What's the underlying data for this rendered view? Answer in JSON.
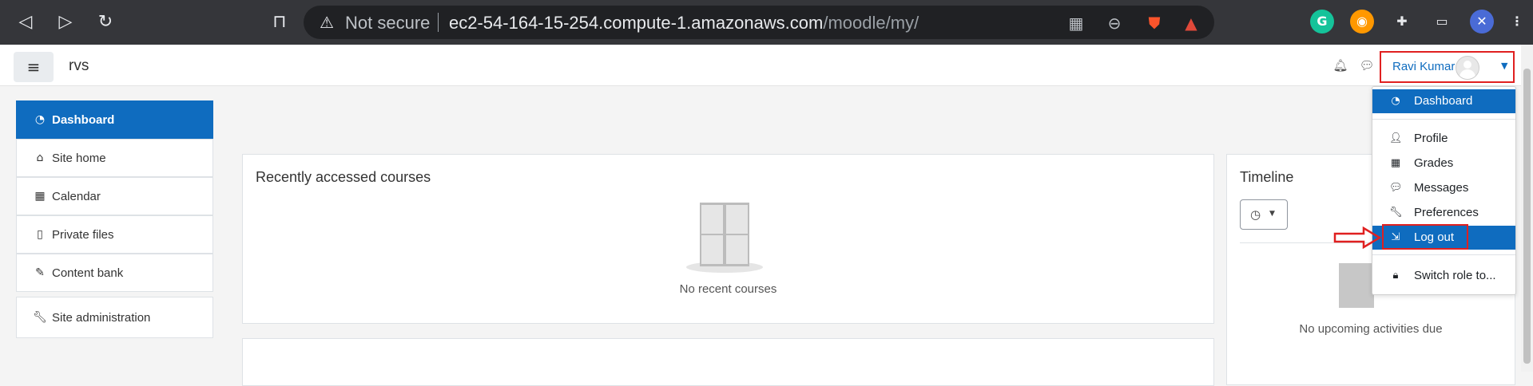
{
  "browser": {
    "back_icon": "back-arrow-icon",
    "forward_icon": "forward-arrow-icon",
    "reload_icon": "reload-icon",
    "bookmark_icon": "bookmark-icon",
    "security_label": "Not secure",
    "url_host": "ec2-54-164-15-254.compute-1.amazonaws.com",
    "url_path": "/moodle/my/",
    "extensions": [
      "grammarly-extension-icon",
      "color-picker-extension-icon",
      "puzzle-extensions-icon",
      "wallet-icon",
      "x-extension-icon",
      "menu-icon"
    ]
  },
  "topnav": {
    "site_name": "rvs",
    "user_name": "Ravi Kumar",
    "notification_icon": "bell-icon",
    "messages_icon": "chat-bubble-icon"
  },
  "drawer": {
    "items": [
      {
        "label": "Dashboard",
        "icon": "dashboard-icon",
        "active": true
      },
      {
        "label": "Site home",
        "icon": "home-icon"
      },
      {
        "label": "Calendar",
        "icon": "calendar-icon"
      },
      {
        "label": "Private files",
        "icon": "file-icon"
      },
      {
        "label": "Content bank",
        "icon": "paintbrush-icon"
      },
      {
        "label": "Site administration",
        "icon": "wrench-icon"
      }
    ]
  },
  "main": {
    "recent_courses_title": "Recently accessed courses",
    "recent_courses_empty": "No recent courses",
    "timeline_title": "Timeline",
    "timeline_empty": "No upcoming activities due"
  },
  "user_dropdown": {
    "items": [
      {
        "label": "Dashboard",
        "icon": "dashboard-icon",
        "active": true
      },
      {
        "label": "Profile",
        "icon": "user-icon"
      },
      {
        "label": "Grades",
        "icon": "table-icon"
      },
      {
        "label": "Messages",
        "icon": "chat-icon"
      },
      {
        "label": "Preferences",
        "icon": "wrench-icon"
      },
      {
        "label": "Log out",
        "icon": "sign-out-icon",
        "highlighted": true
      },
      {
        "label": "Switch role to...",
        "icon": "user-secret-icon"
      }
    ]
  },
  "colors": {
    "brand_blue": "#0f6cbf",
    "annotation_red": "#e02020",
    "browser_chrome": "#35363a"
  }
}
